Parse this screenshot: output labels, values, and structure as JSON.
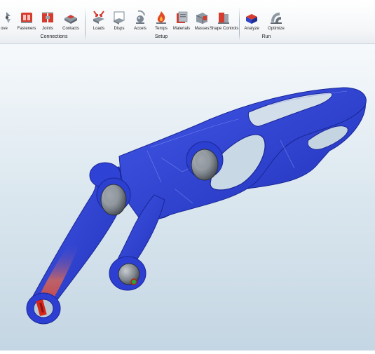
{
  "ribbon": {
    "tools": [
      {
        "id": "move",
        "label": "ove",
        "icon": "move-icon"
      },
      {
        "id": "fasteners",
        "label": "Fasteners",
        "icon": "fasteners-icon"
      },
      {
        "id": "joints",
        "label": "Joints",
        "icon": "joints-icon"
      },
      {
        "id": "contacts",
        "label": "Contacts",
        "icon": "contacts-icon"
      },
      {
        "id": "loads",
        "label": "Loads",
        "icon": "loads-icon"
      },
      {
        "id": "disps",
        "label": "Disps",
        "icon": "disps-icon"
      },
      {
        "id": "accels",
        "label": "Accels",
        "icon": "accels-icon"
      },
      {
        "id": "temps",
        "label": "Temps",
        "icon": "temps-icon"
      },
      {
        "id": "materials",
        "label": "Materials",
        "icon": "materials-icon"
      },
      {
        "id": "masses",
        "label": "Masses",
        "icon": "masses-icon"
      },
      {
        "id": "shape_controls",
        "label": "Shape Controls",
        "icon": "shape-controls-icon"
      },
      {
        "id": "analyze",
        "label": "Analyze",
        "icon": "analyze-icon"
      },
      {
        "id": "optimize",
        "label": "Optimize",
        "icon": "optimize-icon"
      }
    ],
    "groups": {
      "connections": "Connections",
      "setup": "Setup",
      "run": "Run"
    }
  },
  "model": {
    "base_color": "#2b40d8",
    "stress_color": "#e0301e"
  }
}
